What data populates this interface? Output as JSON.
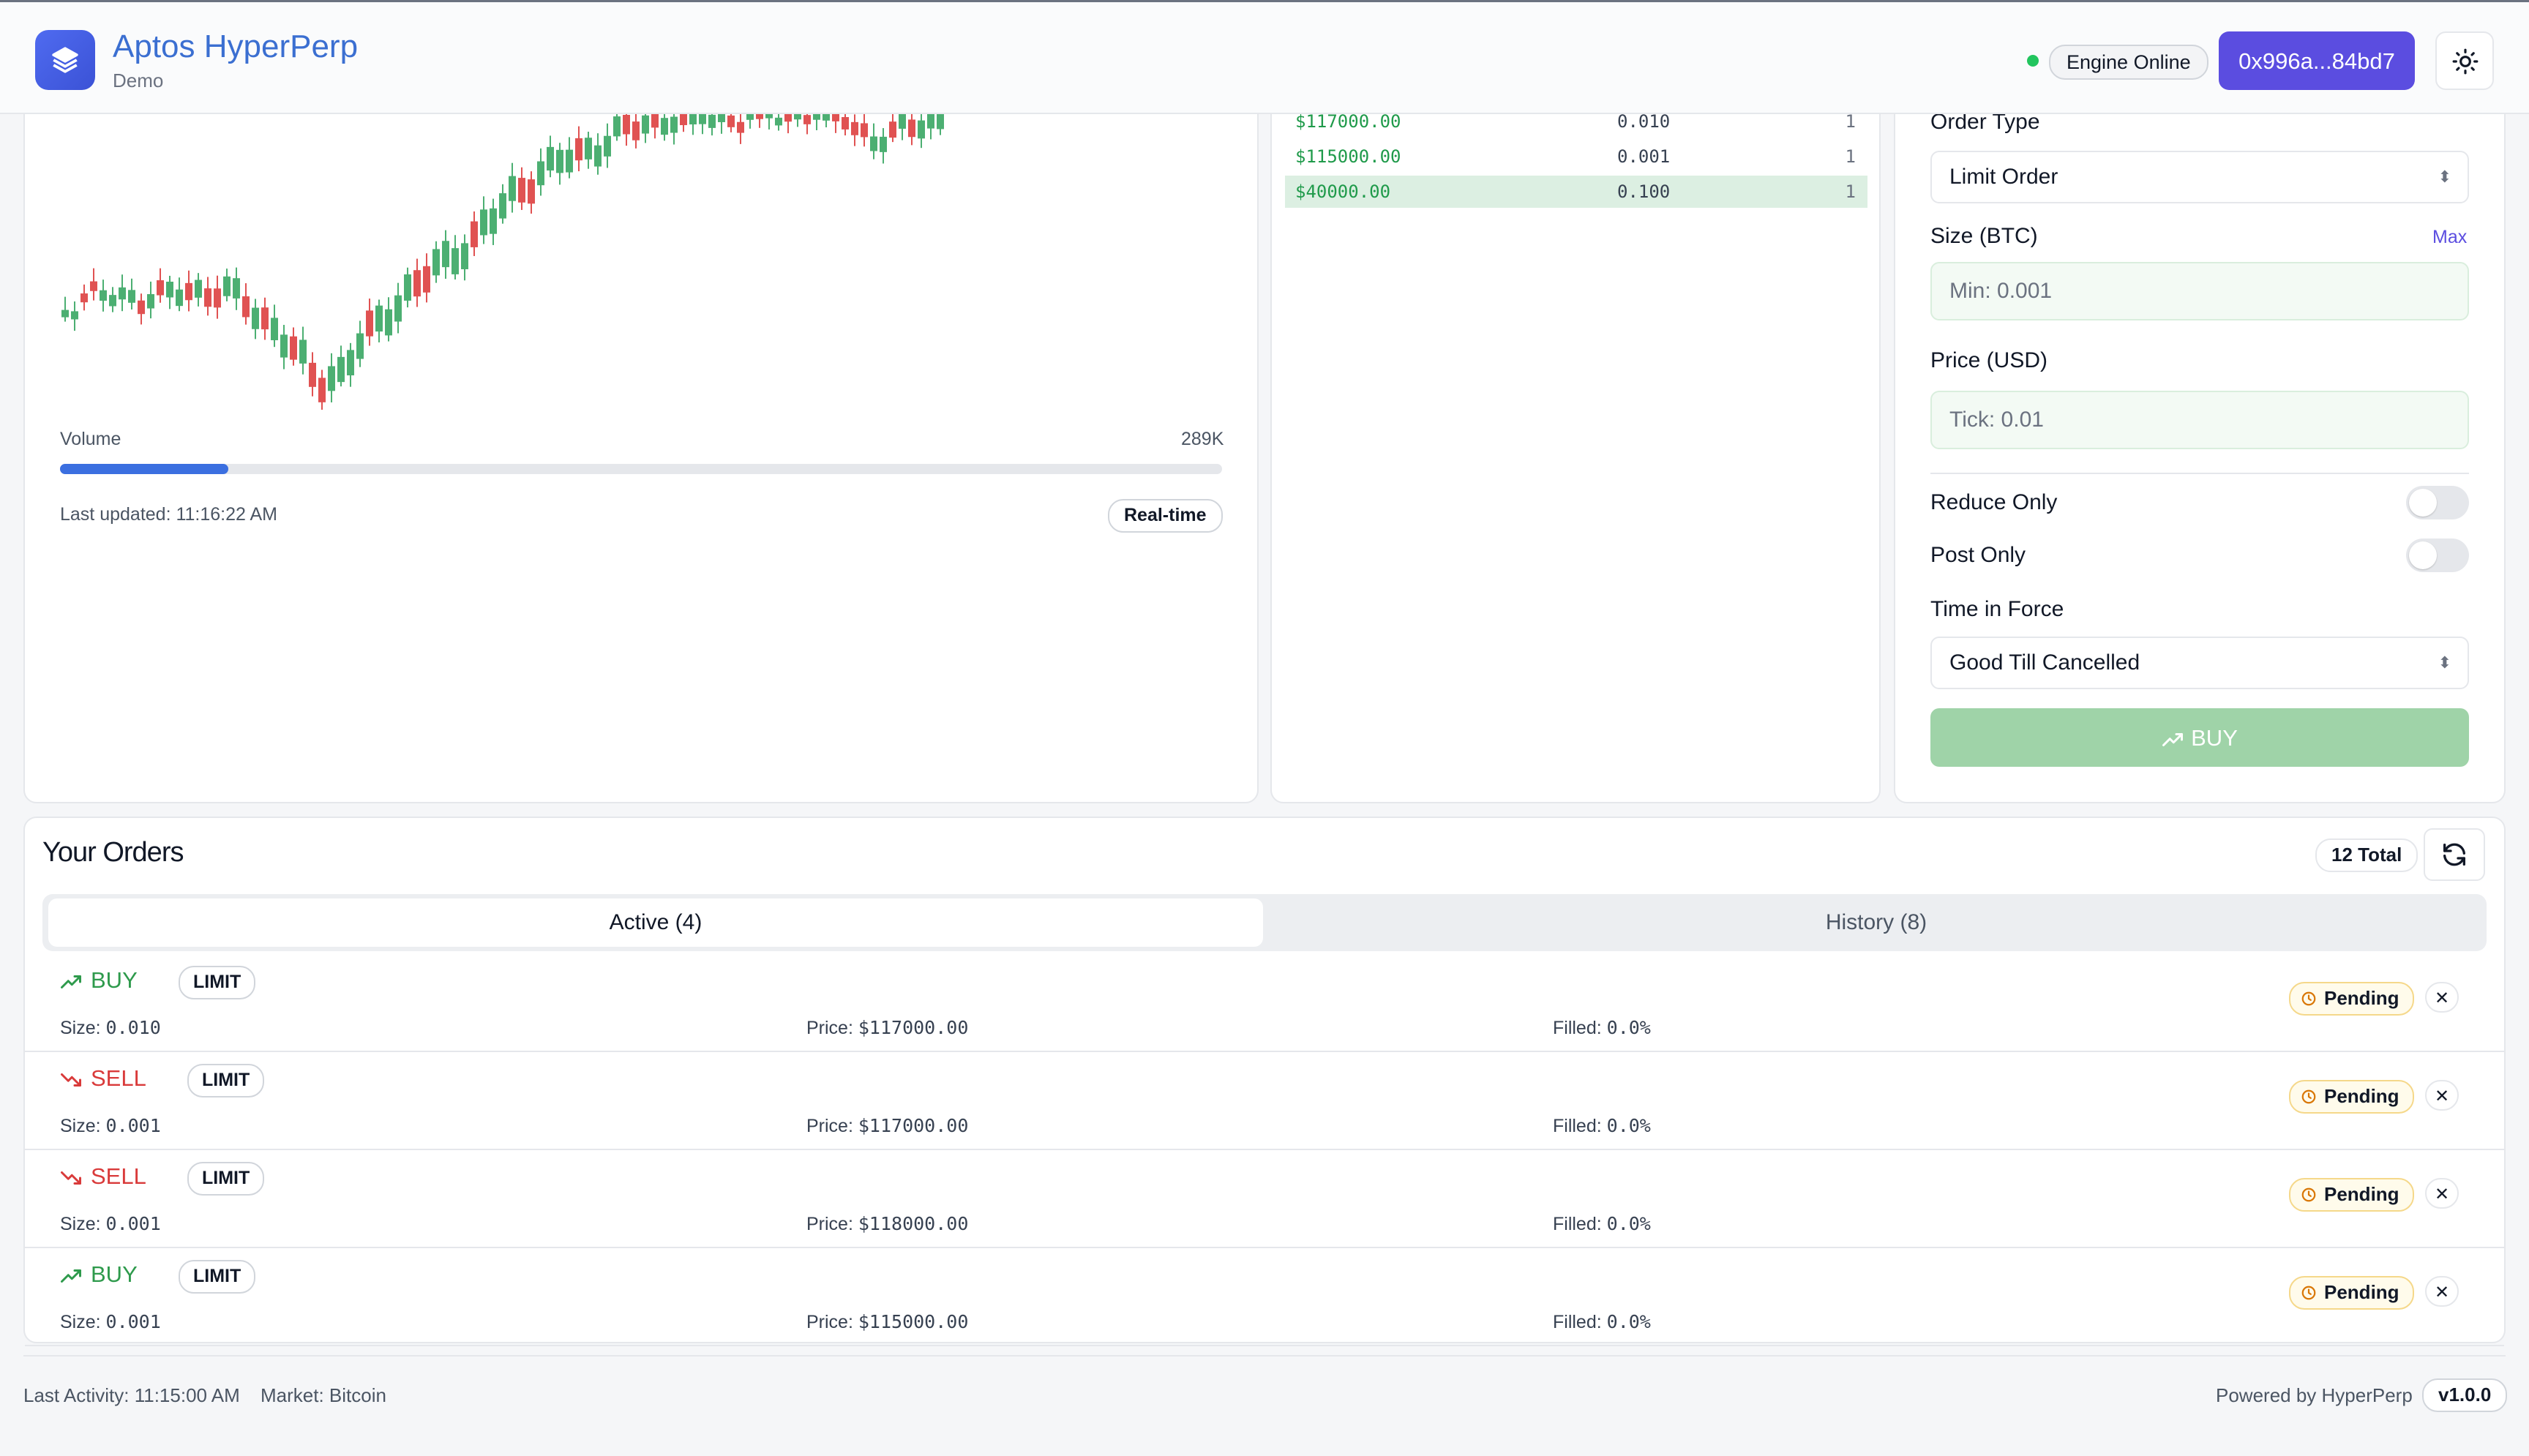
{
  "header": {
    "app_title": "Aptos HyperPerp",
    "app_subtitle": "Demo",
    "engine_status": "Engine Online",
    "wallet": "0x996a...84bd7"
  },
  "chart": {
    "volume_label": "Volume",
    "volume_value": "289K",
    "volume_fill_fraction": 0.145,
    "last_updated": "Last updated: 11:16:22 AM",
    "realtime_badge": "Real-time",
    "colors": {
      "up": "#4caf72",
      "down": "#e05252"
    }
  },
  "order_book": {
    "rows": [
      {
        "price": "$117000.00",
        "size": "0.010",
        "count": "1",
        "highlight": false
      },
      {
        "price": "$115000.00",
        "size": "0.001",
        "count": "1",
        "highlight": false
      },
      {
        "price": "$40000.00",
        "size": "0.100",
        "count": "1",
        "highlight": true
      }
    ]
  },
  "order_form": {
    "order_type_label": "Order Type",
    "order_type_value": "Limit Order",
    "size_label": "Size (BTC)",
    "max_link": "Max",
    "size_placeholder": "Min: 0.001",
    "price_label": "Price (USD)",
    "price_placeholder": "Tick: 0.01",
    "reduce_only_label": "Reduce Only",
    "post_only_label": "Post Only",
    "tif_label": "Time in Force",
    "tif_value": "Good Till Cancelled",
    "buy_button": "BUY"
  },
  "orders": {
    "title": "Your Orders",
    "total_badge": "12 Total",
    "tab_active": "Active (4)",
    "tab_history": "History (8)",
    "size_prefix": "Size: ",
    "price_prefix": "Price: ",
    "filled_prefix": "Filled: ",
    "rows": [
      {
        "side": "BUY",
        "type": "LIMIT",
        "size": "0.010",
        "price": "$117000.00",
        "filled": "0.0%",
        "status": "Pending"
      },
      {
        "side": "SELL",
        "type": "LIMIT",
        "size": "0.001",
        "price": "$117000.00",
        "filled": "0.0%",
        "status": "Pending"
      },
      {
        "side": "SELL",
        "type": "LIMIT",
        "size": "0.001",
        "price": "$118000.00",
        "filled": "0.0%",
        "status": "Pending"
      },
      {
        "side": "BUY",
        "type": "LIMIT",
        "size": "0.001",
        "price": "$115000.00",
        "filled": "0.0%",
        "status": "Pending"
      }
    ],
    "colors": {
      "buy": "#2e9a4c",
      "sell": "#d93a3a"
    }
  },
  "footer": {
    "last_activity": "Last Activity: 11:15:00 AM",
    "market": "Market: Bitcoin",
    "powered_by": "Powered by HyperPerp",
    "version": "v1.0.0"
  }
}
